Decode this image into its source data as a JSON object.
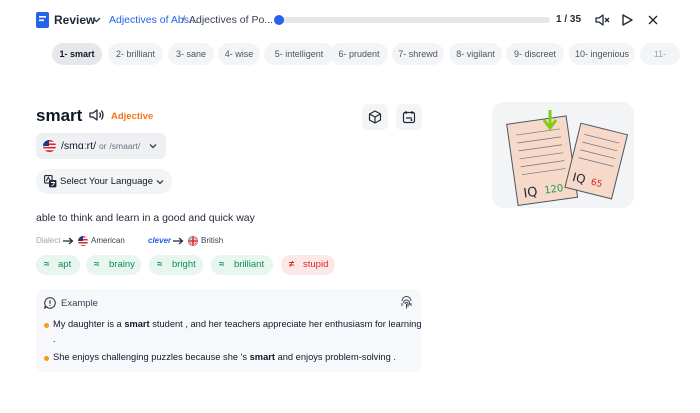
{
  "header": {
    "review_label": "Review",
    "breadcrumb_1": "Adjectives of Abs...",
    "breadcrumb_separator": "/",
    "breadcrumb_2": "Adjectives of Po...",
    "progress_current": 1,
    "progress_total": 35,
    "progress_label": "1 / 35"
  },
  "tabs": [
    "1- smart",
    "2- brilliant",
    "3- sane",
    "4- wise",
    "5- intelligent",
    "6- prudent",
    "7- shrewd",
    "8- vigilant",
    "9- discreet",
    "10- ingenious",
    "11-"
  ],
  "active_tab": 0,
  "word": {
    "text": "smart",
    "part_of_speech": "Adjective",
    "pronunciation": "/smɑːrt/",
    "pronunciation_or": "or",
    "pronunciation_alt": "/smaart/",
    "language_select_label": "Select Your Language",
    "definition": "able to think and learn in a good and quick way"
  },
  "dialect": {
    "label": "Dialect",
    "from": "American",
    "word": "clever",
    "to": "British"
  },
  "synonyms": [
    {
      "symbol": "≈",
      "text": "apt"
    },
    {
      "symbol": "≈",
      "text": "brainy"
    },
    {
      "symbol": "≈",
      "text": "bright"
    },
    {
      "symbol": "≈",
      "text": "brilliant"
    }
  ],
  "antonyms": [
    {
      "symbol": "≠",
      "text": "stupid"
    }
  ],
  "example": {
    "title": "Example",
    "sentence_1_before": "My daughter is a",
    "sentence_1_bold": "smart",
    "sentence_1_after": "student , and her teachers appreciate her enthusiasm for learning",
    "sentence_1_end": ".",
    "sentence_2_before": "She enjoys challenging puzzles because she 's",
    "sentence_2_bold": "smart",
    "sentence_2_after": "and enjoys problem-solving ."
  },
  "illustration": {
    "paper_text_1": "IQ",
    "paper_text_2": "120",
    "paper_text_3": "IQ",
    "paper_text_4": "65"
  },
  "colors": {
    "accent_blue": "#2563eb",
    "pos_orange": "#f97316",
    "synonym_green": "#0f8a5f",
    "antonym_red": "#dc2626"
  },
  "icons": {
    "review": "notebook-icon",
    "mute": "speaker-mute-icon",
    "play": "play-outline-icon",
    "close": "close-icon",
    "speaker": "speaker-icon",
    "cube": "cube-icon",
    "card": "flashcard-icon",
    "translate": "translate-icon",
    "example": "quote-bubble-icon",
    "tap": "fingerprint-icon"
  }
}
